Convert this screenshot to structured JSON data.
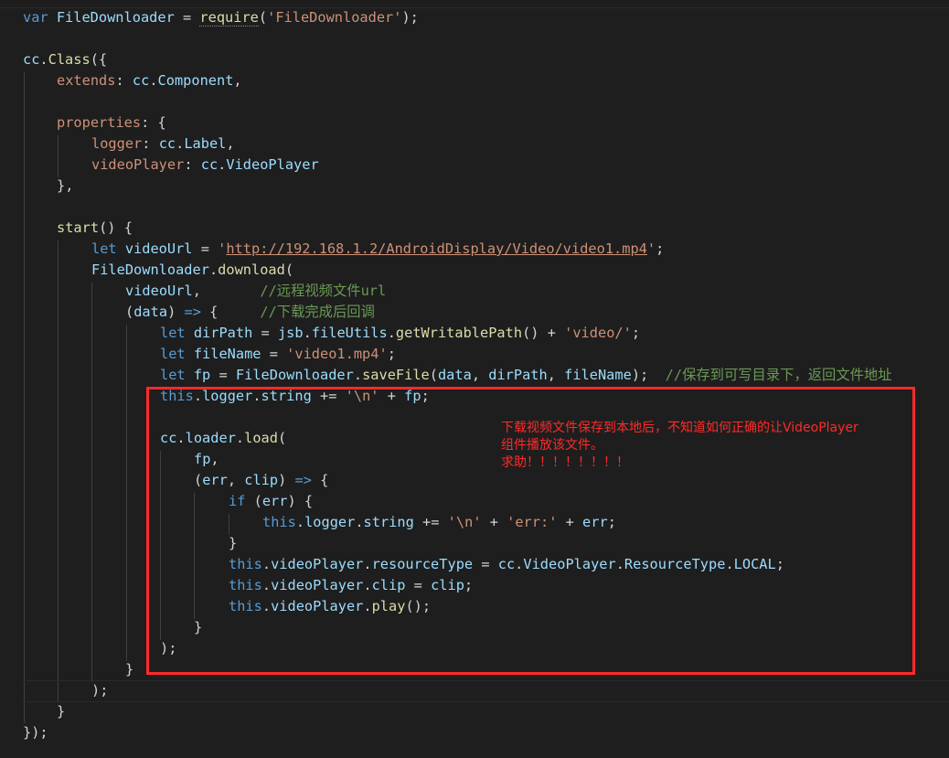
{
  "code_lines": {
    "l1": {
      "t0": "var ",
      "t1": "FileDownloader",
      "t2": " = ",
      "t3": "require",
      "t4": "(",
      "t5": "'FileDownloader'",
      "t6": ");"
    },
    "l3": {
      "t0": "cc",
      "t1": ".",
      "t2": "Class",
      "t3": "({"
    },
    "l4": {
      "t0": "extends",
      "t1": ": ",
      "t2": "cc",
      "t3": ".",
      "t4": "Component",
      "t5": ","
    },
    "l6": {
      "t0": "properties",
      "t1": ": {"
    },
    "l7": {
      "t0": "logger",
      "t1": ": ",
      "t2": "cc",
      "t3": ".",
      "t4": "Label",
      "t5": ","
    },
    "l8": {
      "t0": "videoPlayer",
      "t1": ": ",
      "t2": "cc",
      "t3": ".",
      "t4": "VideoPlayer"
    },
    "l9": {
      "t0": "},"
    },
    "l11": {
      "t0": "start",
      "t1": "() {"
    },
    "l12": {
      "t0": "let ",
      "t1": "videoUrl",
      "t2": " = ",
      "t3": "'",
      "t4": "http://192.168.1.2/AndroidDisplay/Video/video1.mp4",
      "t5": "'",
      "t6": ";"
    },
    "l13": {
      "t0": "FileDownloader",
      "t1": ".",
      "t2": "download",
      "t3": "("
    },
    "l14": {
      "t0": "videoUrl",
      "t1": ",       ",
      "t2": "//远程视频文件url"
    },
    "l15": {
      "t0": "(",
      "t1": "data",
      "t2": ") ",
      "t3": "=>",
      "t4": " {     ",
      "t5": "//下载完成后回调"
    },
    "l16": {
      "t0": "let ",
      "t1": "dirPath",
      "t2": " = ",
      "t3": "jsb",
      "t4": ".",
      "t5": "fileUtils",
      "t6": ".",
      "t7": "getWritablePath",
      "t8": "() + ",
      "t9": "'video/'",
      "t10": ";"
    },
    "l17": {
      "t0": "let ",
      "t1": "fileName",
      "t2": " = ",
      "t3": "'video1.mp4'",
      "t4": ";"
    },
    "l18": {
      "t0": "let ",
      "t1": "fp",
      "t2": " = ",
      "t3": "FileDownloader",
      "t4": ".",
      "t5": "saveFile",
      "t6": "(",
      "t7": "data",
      "t8": ", ",
      "t9": "dirPath",
      "t10": ", ",
      "t11": "fileName",
      "t12": ");  ",
      "t13": "//保存到可写目录下，返回文件地址"
    },
    "l19": {
      "t0": "this",
      "t1": ".",
      "t2": "logger",
      "t3": ".",
      "t4": "string",
      "t5": " += ",
      "t6": "'\\n'",
      "t7": " + ",
      "t8": "fp",
      "t9": ";"
    },
    "l21": {
      "t0": "cc",
      "t1": ".",
      "t2": "loader",
      "t3": ".",
      "t4": "load",
      "t5": "("
    },
    "l22": {
      "t0": "fp",
      "t1": ","
    },
    "l23": {
      "t0": "(",
      "t1": "err",
      "t2": ", ",
      "t3": "clip",
      "t4": ") ",
      "t5": "=>",
      "t6": " {"
    },
    "l24": {
      "t0": "if",
      "t1": " (",
      "t2": "err",
      "t3": ") {"
    },
    "l25": {
      "t0": "this",
      "t1": ".",
      "t2": "logger",
      "t3": ".",
      "t4": "string",
      "t5": " += ",
      "t6": "'\\n'",
      "t7": " + ",
      "t8": "'err:'",
      "t9": " + ",
      "t10": "err",
      "t11": ";"
    },
    "l26": {
      "t0": "}"
    },
    "l27": {
      "t0": "this",
      "t1": ".",
      "t2": "videoPlayer",
      "t3": ".",
      "t4": "resourceType",
      "t5": " = ",
      "t6": "cc",
      "t7": ".",
      "t8": "VideoPlayer",
      "t9": ".",
      "t10": "ResourceType",
      "t11": ".",
      "t12": "LOCAL",
      "t13": ";"
    },
    "l28": {
      "t0": "this",
      "t1": ".",
      "t2": "videoPlayer",
      "t3": ".",
      "t4": "clip",
      "t5": " = ",
      "t6": "clip",
      "t7": ";"
    },
    "l29": {
      "t0": "this",
      "t1": ".",
      "t2": "videoPlayer",
      "t3": ".",
      "t4": "play",
      "t5": "();"
    },
    "l30": {
      "t0": "}"
    },
    "l31": {
      "t0": ");"
    },
    "l32": {
      "t0": "}"
    },
    "l33": {
      "t0": ");"
    },
    "l34": {
      "t0": "}"
    },
    "l35": {
      "t0": "});"
    }
  },
  "annotation": {
    "line1": "下载视频文件保存到本地后，不知道如何正确的让VideoPlayer",
    "line2": "组件播放该文件。",
    "line3": "求助！！！！！！！！"
  },
  "colors": {
    "background": "#1e1e1e",
    "keyword": "#569cd6",
    "identifier": "#9cdcfe",
    "function": "#dcdcaa",
    "string": "#ce9178",
    "comment": "#6a9955",
    "class": "#4ec9b0",
    "highlight": "#ff2a2a"
  }
}
